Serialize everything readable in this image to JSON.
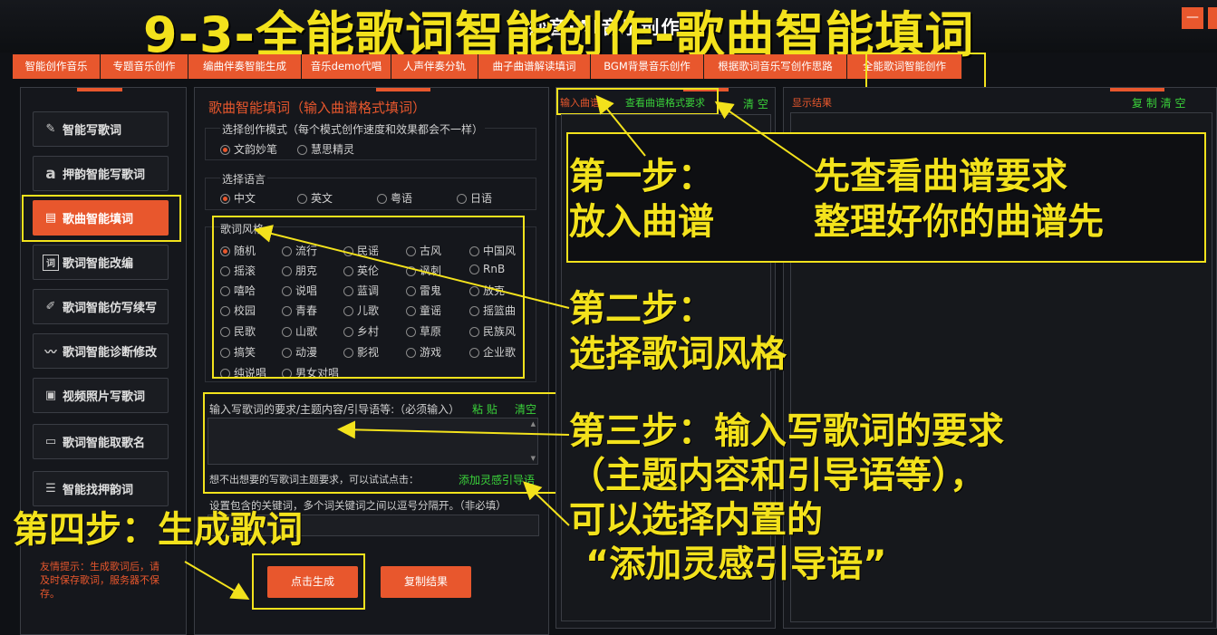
{
  "overlay_title": "9-3-全能歌词智能创作-歌曲智能填词",
  "window": {
    "title": "妙音·AI音乐创作"
  },
  "tabs": [
    "智能创作音乐",
    "专题音乐创作",
    "编曲伴奏智能生成",
    "音乐demo代唱",
    "人声伴奏分轨",
    "曲子曲谱解读填词",
    "BGM背景音乐创作",
    "根据歌词音乐写创作思路",
    "全能歌词智能创作"
  ],
  "sidebar": [
    {
      "label": "智能写歌词",
      "icon": "pen-icon"
    },
    {
      "label": "押韵智能写歌词",
      "icon": "letter-a-icon"
    },
    {
      "label": "歌曲智能填词",
      "icon": "sheet-icon"
    },
    {
      "label": "歌词智能改编",
      "icon": "word-icon"
    },
    {
      "label": "歌词智能仿写续写",
      "icon": "pencil-icon"
    },
    {
      "label": "歌词智能诊断修改",
      "icon": "pulse-icon"
    },
    {
      "label": "视频照片写歌词",
      "icon": "photo-icon"
    },
    {
      "label": "歌词智能取歌名",
      "icon": "tag-icon"
    },
    {
      "label": "智能找押韵词",
      "icon": "sliders-icon"
    }
  ],
  "form": {
    "heading": "歌曲智能填词（输入曲谱格式填词）",
    "mode_label": "选择创作模式（每个模式创作速度和效果都会不一样）",
    "modes": [
      "文韵妙笔",
      "慧思精灵"
    ],
    "language_label": "选择语言",
    "languages": [
      "中文",
      "英文",
      "粤语",
      "日语"
    ],
    "style_label": "歌词风格",
    "styles": [
      "随机",
      "流行",
      "民谣",
      "古风",
      "中国风",
      "摇滚",
      "朋克",
      "英伦",
      "讽刺",
      "RnB",
      "嘻哈",
      "说唱",
      "蓝调",
      "雷鬼",
      "放克",
      "校园",
      "青春",
      "儿歌",
      "童谣",
      "摇篮曲",
      "民歌",
      "山歌",
      "乡村",
      "草原",
      "民族风",
      "搞笑",
      "动漫",
      "影视",
      "游戏",
      "企业歌",
      "纯说唱",
      "男女对唱"
    ],
    "requirements_label": "输入写歌词的要求/主题内容/引导语等:（必须输入）",
    "paste": "粘 贴",
    "clear": "清空",
    "hint_text": "想不出想要的写歌词主题要求，可以试试点击：",
    "add_inspiration": "添加灵感引导语",
    "keywords_label": "设置包含的关键词，多个词关键词之间以逗号分隔开。（非必填）",
    "tip": "友情提示：生成歌词后，请及时保存歌词，服务器不保存。",
    "generate": "点击生成",
    "copy_result": "复制结果"
  },
  "input_panel": {
    "input_sheet": "输入曲谱",
    "view_format": "查看曲谱格式要求",
    "clear": "清 空"
  },
  "result_panel": {
    "title": "显示结果",
    "copy_clear": "复 制  清 空"
  },
  "annotations": {
    "step1_l1": "第一步：",
    "step1_l2": "放入曲谱",
    "check_l1": "先查看曲谱要求",
    "check_l2": "整理好你的曲谱先",
    "step2_l1": "第二步：",
    "step2_l2": "选择歌词风格",
    "step3_l1": "第三步：输入写歌词的要求",
    "step3_l2": "（主题内容和引导语等），",
    "step3_l3": "可以选择内置的",
    "step3_l4": "“添加灵感引导语”",
    "step4": "第四步：生成歌词"
  },
  "colors": {
    "accent": "#e8572d",
    "annotation": "#f3e21c",
    "link": "#3ad23a"
  }
}
